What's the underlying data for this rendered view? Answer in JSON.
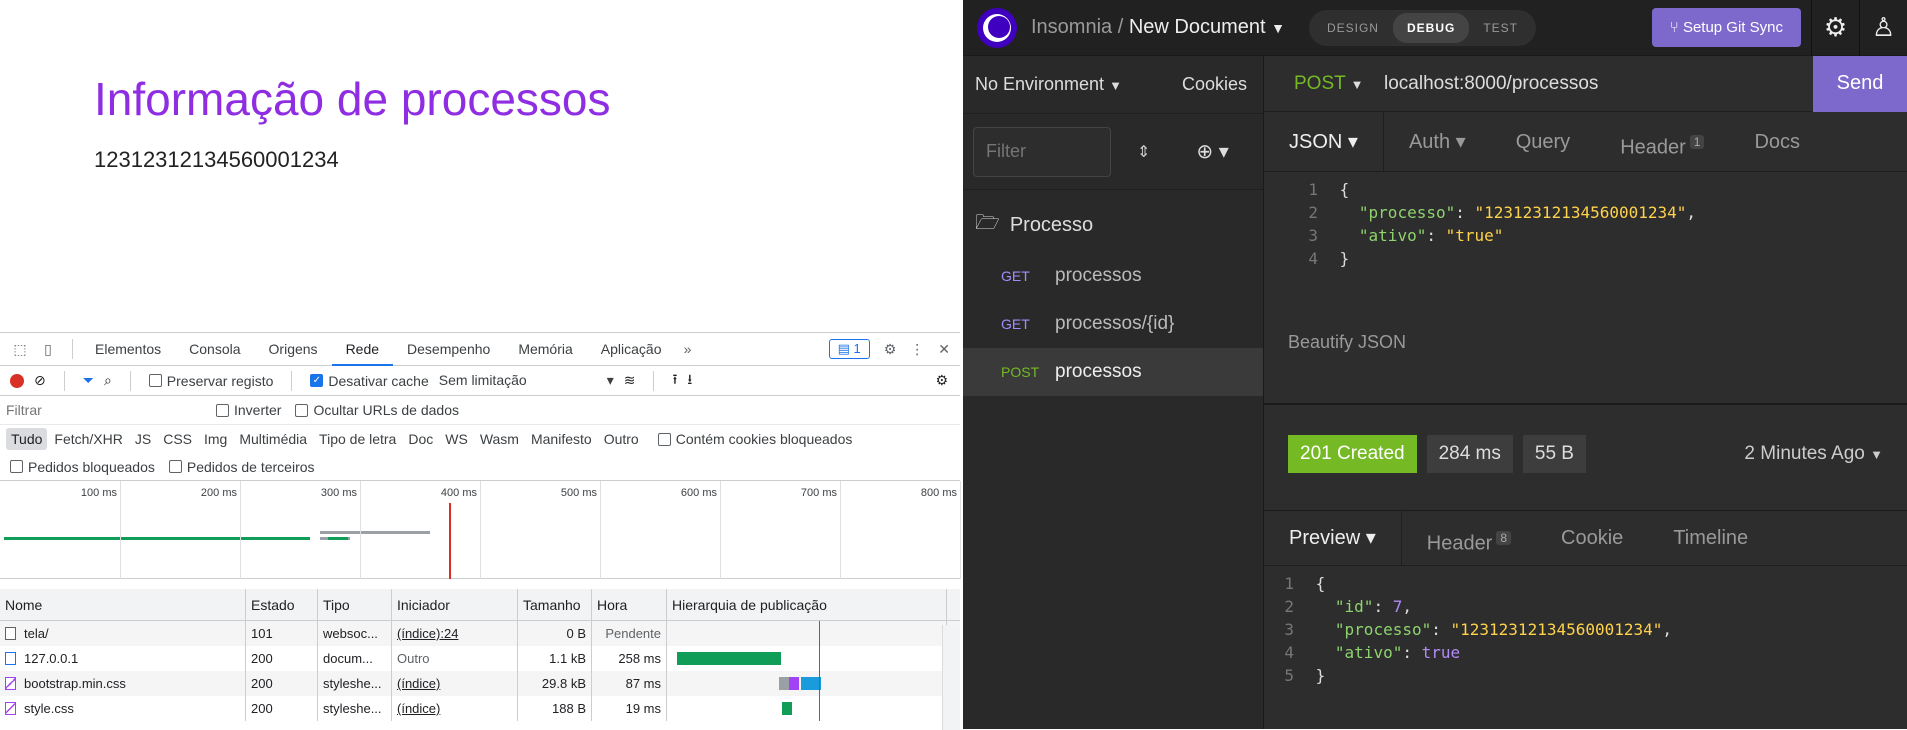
{
  "page": {
    "title": "Informação de processos",
    "value": "12312312134560001234"
  },
  "devtools": {
    "tabs": [
      "Elementos",
      "Consola",
      "Origens",
      "Rede",
      "Desempenho",
      "Memória",
      "Aplicação"
    ],
    "active_tab": "Rede",
    "issues_count": "1",
    "toolbar": {
      "preserve_log": "Preservar registo",
      "disable_cache": "Desativar cache",
      "throttling": "Sem limitação"
    },
    "filter": {
      "placeholder": "Filtrar",
      "invert": "Inverter",
      "hide_data_urls": "Ocultar URLs de dados"
    },
    "types": [
      "Tudo",
      "Fetch/XHR",
      "JS",
      "CSS",
      "Img",
      "Multimédia",
      "Tipo de letra",
      "Doc",
      "WS",
      "Wasm",
      "Manifesto",
      "Outro"
    ],
    "blocked_cookies": "Contém cookies bloqueados",
    "blocked_requests": "Pedidos bloqueados",
    "third_party": "Pedidos de terceiros",
    "timeline_ticks": [
      "100 ms",
      "200 ms",
      "300 ms",
      "400 ms",
      "500 ms",
      "600 ms",
      "700 ms",
      "800 ms"
    ],
    "columns": [
      "Nome",
      "Estado",
      "Tipo",
      "Iniciador",
      "Tamanho",
      "Hora",
      "Hierarquia de publicação"
    ],
    "rows": [
      {
        "name": "tela/",
        "status": "101",
        "type": "websoc...",
        "initiator": "(índice):24",
        "size": "0 B",
        "time": "Pendente",
        "icon": "blank"
      },
      {
        "name": "127.0.0.1",
        "status": "200",
        "type": "docum...",
        "initiator": "Outro",
        "size": "1.1 kB",
        "time": "258 ms",
        "icon": "doc"
      },
      {
        "name": "bootstrap.min.css",
        "status": "200",
        "type": "styleshe...",
        "initiator": "(índice)",
        "size": "29.8 kB",
        "time": "87 ms",
        "icon": "css"
      },
      {
        "name": "style.css",
        "status": "200",
        "type": "styleshe...",
        "initiator": "(índice)",
        "size": "188 B",
        "time": "19 ms",
        "icon": "css"
      }
    ]
  },
  "insomnia": {
    "app": "Insomnia",
    "document": "New Document",
    "modes": [
      "DESIGN",
      "DEBUG",
      "TEST"
    ],
    "active_mode": "DEBUG",
    "git_sync": "Setup Git Sync",
    "environment": "No Environment",
    "cookies": "Cookies",
    "sidebar_filter_placeholder": "Filter",
    "folder": "Processo",
    "requests": [
      {
        "method": "GET",
        "name": "processos",
        "selected": false
      },
      {
        "method": "GET",
        "name": "processos/{id}",
        "selected": false
      },
      {
        "method": "POST",
        "name": "processos",
        "selected": true
      }
    ],
    "request": {
      "method": "POST",
      "url": "localhost:8000/processos",
      "send": "Send",
      "tabs": [
        "JSON",
        "Auth",
        "Query",
        "Header",
        "Docs"
      ],
      "header_count": "1",
      "body_lines": [
        {
          "n": "1",
          "text": "{"
        },
        {
          "n": "2",
          "key": "\"processo\"",
          "value": "\"12312312134560001234\"",
          "tail": ","
        },
        {
          "n": "3",
          "key": "\"ativo\"",
          "value": "\"true\""
        },
        {
          "n": "4",
          "text": "}"
        }
      ],
      "beautify": "Beautify JSON"
    },
    "response": {
      "status": "201 Created",
      "time": "284 ms",
      "size": "55 B",
      "ago": "2 Minutes Ago",
      "tabs": [
        "Preview",
        "Header",
        "Cookie",
        "Timeline"
      ],
      "header_count": "8",
      "body_lines": [
        {
          "n": "1",
          "text": "{"
        },
        {
          "n": "2",
          "key": "\"id\"",
          "value": "7",
          "tail": ",",
          "vtype": "n"
        },
        {
          "n": "3",
          "key": "\"processo\"",
          "value": "\"12312312134560001234\"",
          "tail": ",",
          "vtype": "s"
        },
        {
          "n": "4",
          "key": "\"ativo\"",
          "value": "true",
          "vtype": "n"
        },
        {
          "n": "5",
          "text": "}"
        }
      ]
    },
    "colors": {
      "accent": "#7d69cb",
      "post": "#75ba24",
      "get": "#a38dfa",
      "ok": "#75ba24"
    }
  }
}
